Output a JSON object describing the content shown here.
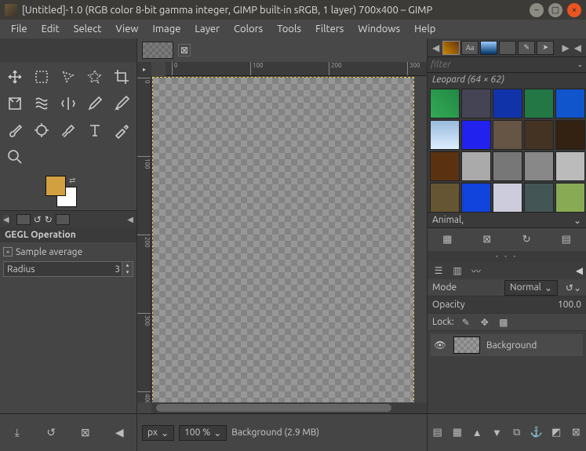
{
  "title": "[Untitled]-1.0 (RGB color 8-bit gamma integer, GIMP built-in sRGB, 1 layer) 700x400 – GIMP",
  "menu": [
    "File",
    "Edit",
    "Select",
    "View",
    "Image",
    "Layer",
    "Colors",
    "Tools",
    "Filters",
    "Windows",
    "Help"
  ],
  "tools": [
    "move",
    "rect-select",
    "free-select",
    "fuzzy-select",
    "crop",
    "rotate",
    "warp",
    "flip",
    "pencil",
    "ink",
    "brush",
    "clone",
    "heal",
    "text",
    "color-picker",
    "zoom"
  ],
  "swatch": {
    "fg": "#d2a040",
    "bg": "#ffffff"
  },
  "tool_options": {
    "title": "GEGL Operation",
    "sample_average_checked": true,
    "sample_average_label": "Sample average",
    "radius_label": "Radius",
    "radius_value": "3"
  },
  "ruler_h": [
    "0",
    "100",
    "200",
    "300"
  ],
  "ruler_v": [
    "0",
    "100",
    "200",
    "300",
    "400"
  ],
  "dock_tabs": [
    "patterns",
    "fonts",
    "images",
    "histogram",
    "paint",
    "tool"
  ],
  "filter_placeholder": "filter",
  "pattern_selected": "Leopard (64 × 62)",
  "pattern_colors": [
    "linear-gradient(45deg,#3a5,#284)",
    "#445",
    "#13a",
    "#274",
    "#15c",
    "linear-gradient(#9bd,#def)",
    "#22e",
    "#654",
    "#432",
    "#321",
    "#5a3212",
    "#aaa",
    "#777",
    "#888",
    "#bbb",
    "#653",
    "#14d",
    "#ccd",
    "#455",
    "#8a5",
    "#333",
    "#4a2a18",
    "radial-gradient(#e8c060 30%,#2a1a08 32%)",
    "#248",
    "#295"
  ],
  "pattern_category": "Animal,",
  "layers": {
    "mode_label": "Mode",
    "mode_value": "Normal",
    "opacity_label": "Opacity",
    "opacity_value": "100.0",
    "lock_label": "Lock:",
    "items": [
      {
        "name": "Background",
        "visible": true
      }
    ]
  },
  "statusbar": {
    "unit": "px",
    "zoom": "100 %",
    "status": "Background (2.9 MB)"
  }
}
